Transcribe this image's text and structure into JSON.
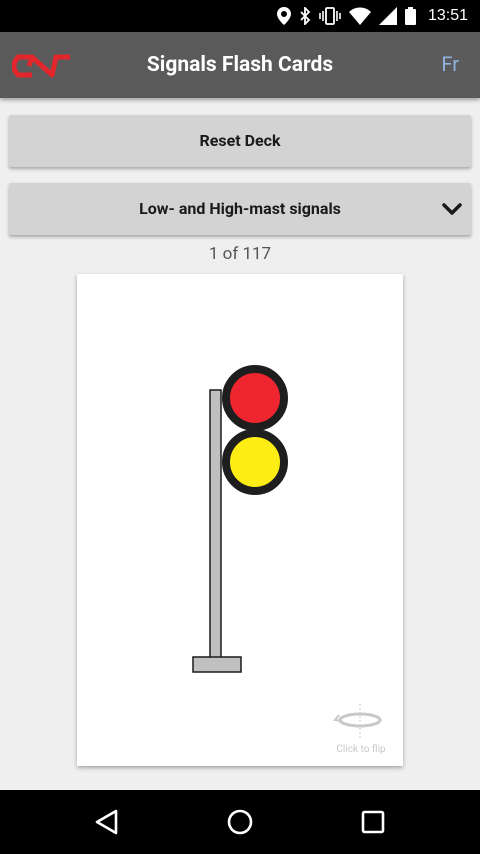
{
  "status_bar": {
    "time": "13:51",
    "icons": [
      "location-icon",
      "bluetooth-icon",
      "vibrate-icon",
      "wifi-icon",
      "cell-signal-icon",
      "battery-icon"
    ]
  },
  "app_bar": {
    "logo_icon": "cn-logo",
    "title": "Signals Flash Cards",
    "language_toggle": "Fr",
    "colors": {
      "background": "#5a5a5a",
      "logo": "#e2262c",
      "language_link": "#8fb3e0"
    }
  },
  "controls": {
    "reset_label": "Reset Deck",
    "deck_selected": "Low- and High-mast signals",
    "deck_icon": "chevron-down-icon"
  },
  "counter": {
    "text": "1 of 117"
  },
  "card": {
    "signal_lights": [
      {
        "name": "red",
        "color": "#ef2630"
      },
      {
        "name": "yellow",
        "color": "#fded14"
      }
    ],
    "mast_color": "#c0c0c0",
    "flip_icon": "flip-icon",
    "flip_label": "Click to flip"
  },
  "nav_bar": {
    "icons": [
      "back-icon",
      "home-icon",
      "recent-apps-icon"
    ]
  }
}
